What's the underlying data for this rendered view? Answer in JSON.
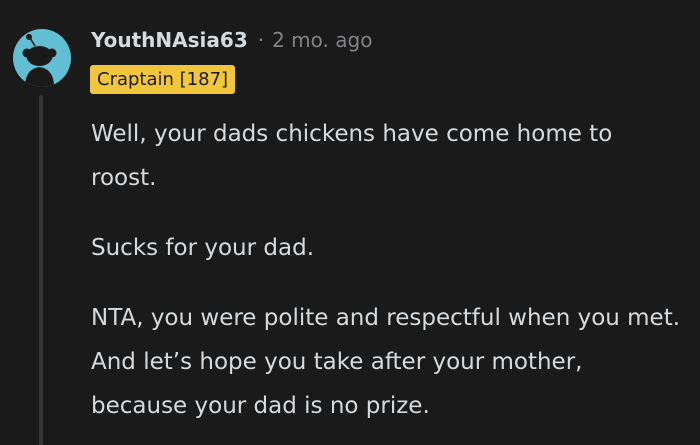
{
  "comment": {
    "username": "YouthNAsia63",
    "separator": "·",
    "timestamp": "2 mo. ago",
    "flair": "Craptain [187]",
    "paragraphs": [
      "Well, your dads chickens have come home to roost.",
      "Sucks for your dad.",
      "NTA, you were polite and respectful when you met. And let’s hope you take after your mother, because your dad is no prize."
    ]
  },
  "colors": {
    "background": "#1a1a1b",
    "avatar_bg": "#62bed3",
    "flair_bg": "#f2c63c",
    "text": "#d7dadc",
    "meta_text": "#818384"
  },
  "icons": {
    "avatar": "reddit-snoo-avatar-icon"
  }
}
